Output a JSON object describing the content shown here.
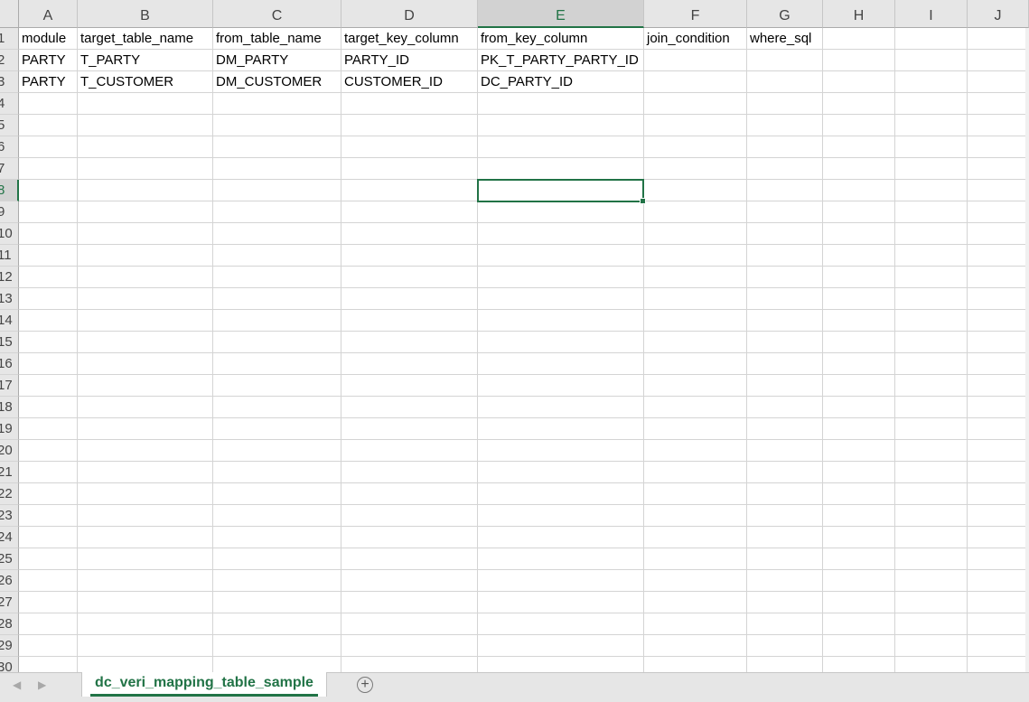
{
  "columns": [
    "A",
    "B",
    "C",
    "D",
    "E",
    "F",
    "G",
    "H",
    "I",
    "J"
  ],
  "selected_column": "E",
  "row_numbers": [
    "1",
    "2",
    "3",
    "4",
    "5",
    "6",
    "7",
    "8",
    "9",
    "10",
    "11",
    "12",
    "13",
    "14",
    "15",
    "16",
    "17",
    "18",
    "19",
    "20",
    "21",
    "22",
    "23",
    "24",
    "25",
    "26",
    "27",
    "28",
    "29",
    "30"
  ],
  "selected_row": "8",
  "cells": [
    [
      "module",
      "target_table_name",
      "from_table_name",
      "target_key_column",
      "from_key_column",
      "join_condition",
      "where_sql"
    ],
    [
      "PARTY",
      "T_PARTY",
      "DM_PARTY",
      "PARTY_ID",
      "PK_T_PARTY_PARTY_ID",
      "",
      ""
    ],
    [
      "PARTY",
      "T_CUSTOMER",
      "DM_CUSTOMER",
      "CUSTOMER_ID",
      "DC_PARTY_ID",
      "",
      ""
    ]
  ],
  "active_cell": "E8",
  "sheet_tab": {
    "label": "dc_veri_mapping_table_sample",
    "add_icon": "plus-circle-icon"
  },
  "nav_icons": [
    "scroll-left-icon",
    "scroll-right-icon"
  ],
  "colors": {
    "accent": "#217346",
    "header_bg": "#e6e6e6",
    "grid": "#d4d4d4"
  }
}
